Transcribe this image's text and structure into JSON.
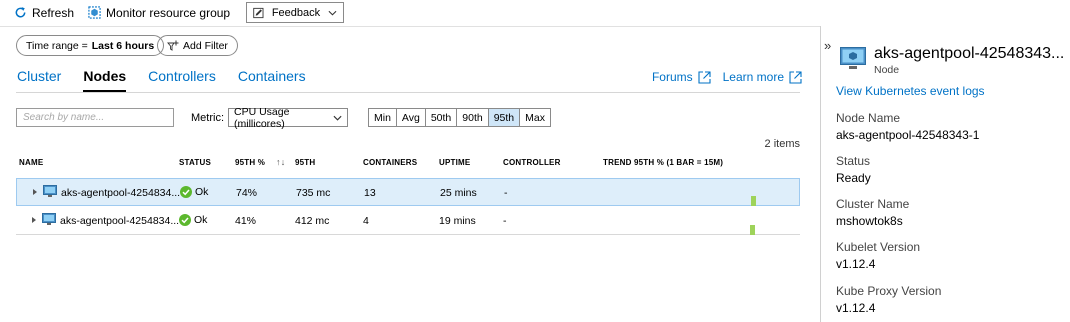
{
  "toolbar": {
    "refresh_label": "Refresh",
    "monitor_label": "Monitor resource group",
    "feedback_label": "Feedback"
  },
  "filters": {
    "time_range_prefix": "Time range = ",
    "time_range_value": "Last 6 hours",
    "add_filter_label": "Add Filter"
  },
  "tabs": [
    {
      "label": "Cluster",
      "active": false
    },
    {
      "label": "Nodes",
      "active": true
    },
    {
      "label": "Controllers",
      "active": false
    },
    {
      "label": "Containers",
      "active": false
    }
  ],
  "links": {
    "forums": "Forums",
    "learn_more": "Learn more"
  },
  "search": {
    "placeholder": "Search by name..."
  },
  "metric": {
    "label": "Metric:",
    "selected": "CPU Usage (millicores)"
  },
  "percentiles": {
    "options": [
      "Min",
      "Avg",
      "50th",
      "90th",
      "95th",
      "Max"
    ],
    "selected": "95th"
  },
  "items_count": "2 items",
  "table": {
    "columns": {
      "name": "NAME",
      "status": "STATUS",
      "pct95": "95TH %",
      "sort_arrow": "↑↓",
      "p95": "95TH",
      "containers": "CONTAINERS",
      "uptime": "UPTIME",
      "controller": "CONTROLLER",
      "trend": "TREND 95TH % (1 BAR = 15M)"
    },
    "rows": [
      {
        "name": "aks-agentpool-4254834...",
        "status": "Ok",
        "pct95": "74%",
        "p95": "735 mc",
        "containers": "13",
        "uptime": "25 mins",
        "controller": "-",
        "selected": true
      },
      {
        "name": "aks-agentpool-4254834...",
        "status": "Ok",
        "pct95": "41%",
        "p95": "412 mc",
        "containers": "4",
        "uptime": "19 mins",
        "controller": "-",
        "selected": false
      }
    ]
  },
  "panel": {
    "collapse_glyph": "»",
    "title": "aks-agentpool-42548343...",
    "subtitle": "Node",
    "link": "View Kubernetes event logs",
    "props": [
      {
        "label": "Node Name",
        "value": "aks-agentpool-42548343-1"
      },
      {
        "label": "Status",
        "value": "Ready"
      },
      {
        "label": "Cluster Name",
        "value": "mshowtok8s"
      },
      {
        "label": "Kubelet Version",
        "value": "v1.12.4"
      },
      {
        "label": "Kube Proxy Version",
        "value": "v1.12.4"
      }
    ]
  },
  "colors": {
    "accent": "#0072c6",
    "selected_row": "#deeefa",
    "ok_green": "#5cb82e",
    "trend_bar": "#9ed35a"
  }
}
